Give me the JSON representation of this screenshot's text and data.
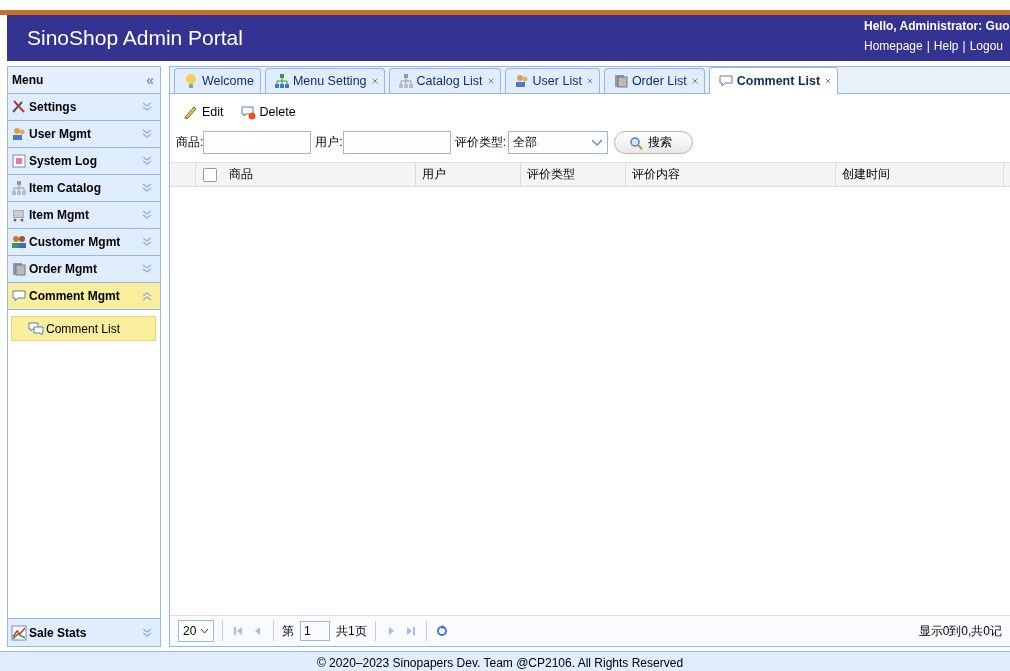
{
  "header": {
    "title": "SinoShop Admin Portal",
    "greeting": "Hello, Administrator: Guo",
    "links": [
      "Homepage",
      "Help",
      "Logou"
    ],
    "separator": "|"
  },
  "sidebar": {
    "title": "Menu",
    "collapse_icon": "«",
    "items": [
      {
        "label": "Settings",
        "expanded": false,
        "selected": false
      },
      {
        "label": "User Mgmt",
        "expanded": false,
        "selected": false
      },
      {
        "label": "System Log",
        "expanded": false,
        "selected": false
      },
      {
        "label": "Item Catalog",
        "expanded": false,
        "selected": false
      },
      {
        "label": "Item Mgmt",
        "expanded": false,
        "selected": false
      },
      {
        "label": "Customer Mgmt",
        "expanded": false,
        "selected": false
      },
      {
        "label": "Order Mgmt",
        "expanded": false,
        "selected": false
      },
      {
        "label": "Comment Mgmt",
        "expanded": true,
        "selected": true,
        "children": [
          {
            "label": "Comment List",
            "selected": true
          }
        ]
      }
    ],
    "bottom_items": [
      {
        "label": "Sale Stats",
        "expanded": false,
        "selected": false
      }
    ]
  },
  "tabs": [
    {
      "label": "Welcome",
      "closable": false,
      "selected": false
    },
    {
      "label": "Menu Setting",
      "closable": true,
      "selected": false
    },
    {
      "label": "Catalog List",
      "closable": true,
      "selected": false
    },
    {
      "label": "User List",
      "closable": true,
      "selected": false
    },
    {
      "label": "Order List",
      "closable": true,
      "selected": false
    },
    {
      "label": "Comment List",
      "closable": true,
      "selected": true
    }
  ],
  "toolbar": [
    "Edit",
    "Delete"
  ],
  "search": {
    "fields": [
      {
        "label": "商品:"
      },
      {
        "label": "用户:"
      }
    ],
    "type_label": "评价类型:",
    "type_value": "全部",
    "button": "搜索"
  },
  "table": {
    "columns": [
      "商品",
      "用户",
      "评价类型",
      "评价内容",
      "创建时间"
    ],
    "all_checked": false
  },
  "pager": {
    "page_size": "20",
    "page_prefix": "第",
    "page": "1",
    "page_total": "共1页",
    "summary": "显示0到0,共0记"
  },
  "footer": "© 2020–2023 Sinopapers Dev. Team @CP2106. All Rights Reserved"
}
